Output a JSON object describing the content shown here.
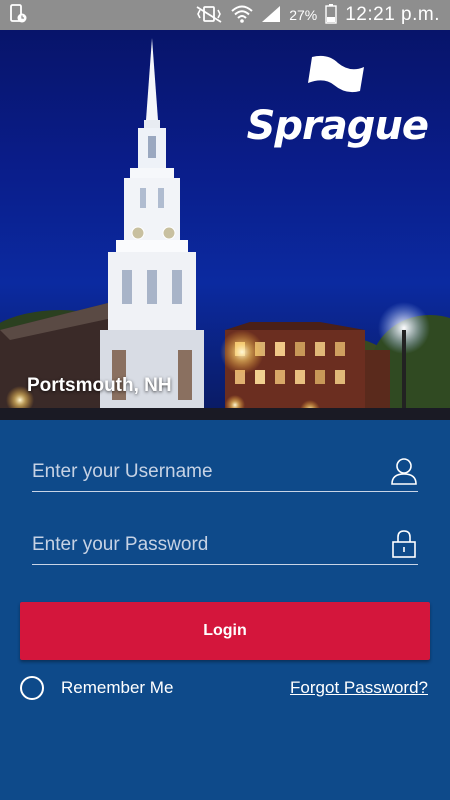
{
  "status_bar": {
    "battery_percent": "27%",
    "time": "12:21 p.m."
  },
  "hero": {
    "location": "Portsmouth, NH",
    "logo_text": "Sprague"
  },
  "login_form": {
    "username_placeholder": "Enter your Username",
    "password_placeholder": "Enter your Password",
    "login_label": "Login",
    "remember_label": "Remember Me",
    "forgot_label": "Forgot Password?"
  },
  "colors": {
    "background": "#0e4a8a",
    "status_bar": "#8e8e8e",
    "login_button": "#d4163c",
    "text": "#ffffff"
  },
  "icons": [
    "phone-notification-icon",
    "vibrate-icon",
    "wifi-icon",
    "signal-icon",
    "battery-icon",
    "user-icon",
    "lock-icon",
    "radio-unchecked-icon",
    "flag-logo-icon"
  ]
}
